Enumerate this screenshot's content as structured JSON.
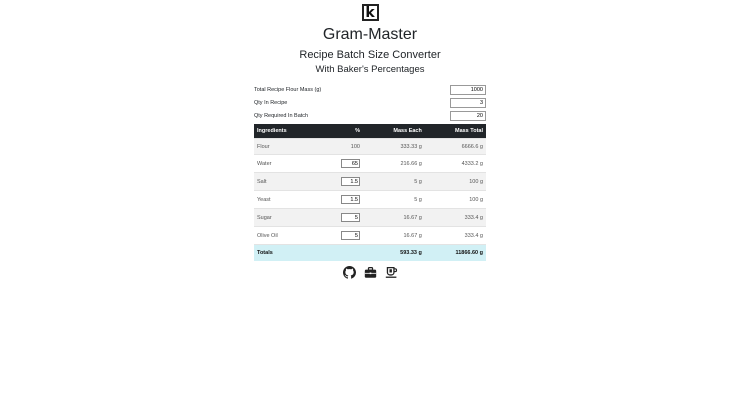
{
  "logo_letter": "k",
  "app_title": "Gram-Master",
  "subtitle": "Recipe Batch Size Converter",
  "tagline": "With Baker's Percentages",
  "form": {
    "flour_label": "Total Recipe Flour Mass (g)",
    "flour_value": "1000",
    "qty_label": "Qty In Recipe",
    "qty_value": "3",
    "batch_label": "Qty Required In Batch",
    "batch_value": "20"
  },
  "table": {
    "headers": [
      "Ingredients",
      "%",
      "Mass Each",
      "Mass Total"
    ],
    "rows": [
      {
        "name": "Flour",
        "pct": "100",
        "each": "333.33 g",
        "total": "6666.6 g"
      },
      {
        "name": "Water",
        "pct": "65",
        "each": "216.66 g",
        "total": "4333.2 g"
      },
      {
        "name": "Salt",
        "pct": "1.5",
        "each": "5 g",
        "total": "100 g"
      },
      {
        "name": "Yeast",
        "pct": "1.5",
        "each": "5 g",
        "total": "100 g"
      },
      {
        "name": "Sugar",
        "pct": "5",
        "each": "16.67 g",
        "total": "333.4 g"
      },
      {
        "name": "Olive Oil",
        "pct": "5",
        "each": "16.67 g",
        "total": "333.4 g"
      }
    ],
    "totals": {
      "label": "Totals",
      "each": "593.33 g",
      "total": "11866.60 g"
    }
  },
  "footer_icons": [
    "github-icon",
    "briefcase-icon",
    "coffee-icon"
  ]
}
